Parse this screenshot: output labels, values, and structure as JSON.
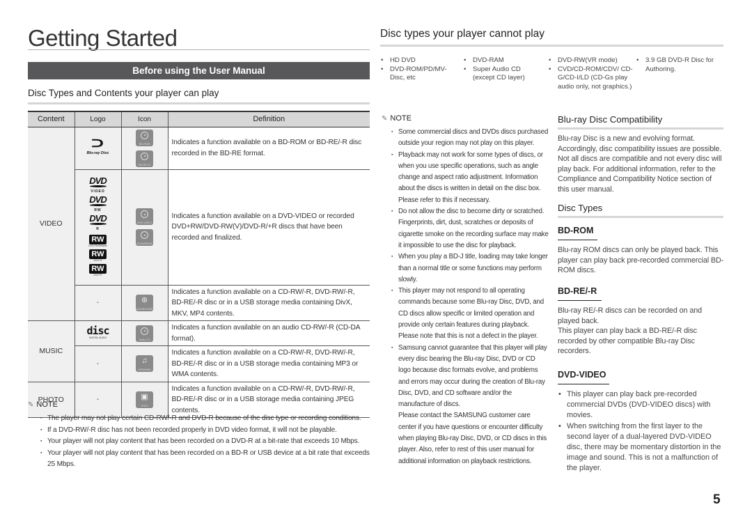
{
  "page": {
    "title": "Getting Started",
    "banner": "Before using the User Manual",
    "page_number": "5"
  },
  "can_play": {
    "heading": "Disc Types and Contents your player can play",
    "columns": [
      "Content",
      "Logo",
      "Icon",
      "Definition"
    ],
    "rows": [
      {
        "content": "VIDEO",
        "logos": [
          "blu-ray-disc-logo"
        ],
        "icons": [
          {
            "name": "bd-rom-icon",
            "caption": "BD-ROM"
          },
          {
            "name": "bd-re-r-icon",
            "caption": "BD-RE/-R"
          }
        ],
        "definition": "Indicates a function available on a BD-ROM or BD-RE/-R disc recorded in the BD-RE format."
      },
      {
        "content": "VIDEO",
        "logos": [
          {
            "name": "dvd-video-logo",
            "text": "DVD",
            "sub": "VIDEO"
          },
          {
            "name": "dvd-rw-logo",
            "text": "DVD",
            "sub": "RW"
          },
          {
            "name": "dvd-r-logo",
            "text": "DVD",
            "sub": "R"
          },
          {
            "name": "rw-dvd-plus-rw-logo",
            "text": "RW",
            "sub": "DVD+ReWritable"
          },
          {
            "name": "rw-dvd-plus-r-logo",
            "text": "RW",
            "sub": "DVD+R"
          },
          {
            "name": "rw-dvd-r-logo",
            "text": "RW",
            "sub": "DVD+R"
          }
        ],
        "icons": [
          {
            "name": "dvd-video-icon",
            "caption": "DVD-VIDEO"
          },
          {
            "name": "dvd-rw-r-icon",
            "caption": "DVD±RW/±R"
          }
        ],
        "definition": "Indicates a function available on a DVD-VIDEO or recorded DVD+RW/DVD-RW(V)/DVD-R/+R discs that have been recorded and finalized."
      },
      {
        "content": "VIDEO",
        "logo_text": "-",
        "icons": [
          {
            "name": "divx-mkv-mp4-icon",
            "caption": "DivX/MKV/MP4"
          }
        ],
        "definition": "Indicates a function available on a CD-RW/-R, DVD-RW/-R, BD-RE/-R disc or in a USB storage media containing DivX, MKV, MP4 contents."
      },
      {
        "content": "MUSIC",
        "logo": {
          "text": "disc",
          "sub": "DIGITAL AUDIO"
        },
        "icons": [
          {
            "name": "audio-cd-icon",
            "caption": "Audio CD"
          }
        ],
        "definition": "Indicates a function available on an audio CD-RW/-R (CD-DA format)."
      },
      {
        "content": "MUSIC",
        "logo_text": "-",
        "icons": [
          {
            "name": "mp3-wma-icon",
            "caption": "MP3/WMA"
          }
        ],
        "definition": "Indicates a function available on a CD-RW/-R, DVD-RW/-R, BD-RE/-R disc or in a USB storage media containing MP3 or WMA contents."
      },
      {
        "content": "PHOTO",
        "logo_text": "-",
        "icons": [
          {
            "name": "jpeg-icon",
            "caption": "JPEG"
          }
        ],
        "definition": "Indicates a function available on a CD-RW/-R, DVD-RW/-R, BD-RE/-R disc or in a USB storage media containing JPEG contents."
      }
    ],
    "note": {
      "label": "NOTE",
      "items": [
        "The player may not play certain CD-RW/-R and DVD-R because of the disc type or recording conditions.",
        "If a DVD-RW/-R disc has not been recorded properly in DVD video format, it will not be playable.",
        "Your player will not play content that has been recorded on a DVD-R at a bit-rate that exceeds 10 Mbps.",
        "Your player will not play content that has been recorded on a BD-R or USB device at a bit rate that exceeds 25 Mbps."
      ]
    }
  },
  "cannot_play": {
    "heading": "Disc types your player cannot play",
    "columns": [
      [
        "HD DVD",
        "DVD-ROM/PD/MV-Disc, etc"
      ],
      [
        "DVD-RAM",
        "Super Audio CD (except CD layer)"
      ],
      [
        "DVD-RW(VR mode)",
        "CVD/CD-ROM/CDV/ CD-G/CD-I/LD (CD-Gs play audio only, not graphics.)"
      ],
      [
        "3.9 GB DVD-R Disc for Authoring."
      ]
    ],
    "note": {
      "label": "NOTE",
      "items": [
        "Some commercial discs and DVDs discs purchased outside your region may not play on this player.",
        "Playback may not work for some types of discs, or when you use specific operations, such as angle change and aspect ratio adjustment. Information about the discs is written in detail on the disc box. Please refer to this if necessary.",
        "Do not allow the disc to become dirty or scratched. Fingerprints, dirt, dust, scratches or deposits of cigarette smoke on the recording surface may make it impossible to use the disc for playback.",
        "When you play a BD-J title, loading may take longer than a normal title or some functions may perform slowly.",
        "This player may not respond to all operating commands because some Blu-ray Disc, DVD, and CD discs allow specific or limited operation and provide only certain features during playback. Please note that this is not a defect in the player.",
        "Samsung cannot guarantee that this player will play every disc bearing the Blu-ray Disc, DVD or CD logo because disc formats evolve, and problems and errors may occur during the creation of Blu-ray Disc, DVD, and CD software and/or the manufacture of discs."
      ],
      "continuation": "Please contact the SAMSUNG customer care center if you have questions or encounter difficulty when playing Blu-ray Disc, DVD, or CD discs in this player. Also, refer to rest of this user manual for additional information on playback restrictions."
    }
  },
  "compatibility": {
    "heading": "Blu-ray Disc Compatibility",
    "text": "Blu-ray Disc is a new and evolving format. Accordingly, disc compatibility issues are possible. Not all discs are compatible and not every disc will play back. For additional information, refer to the Compliance and Compatibility Notice section of this user manual."
  },
  "disc_types": {
    "heading": "Disc Types",
    "bd_rom": {
      "heading": "BD-ROM",
      "text": "Blu-ray ROM discs can only be played back. This player can play back pre-recorded commercial BD-ROM discs."
    },
    "bd_re_r": {
      "heading": "BD-RE/-R",
      "text1": "Blu-ray RE/-R discs can be recorded on and played back.",
      "text2": "This player can play back a BD-RE/-R disc recorded by other compatible Blu-ray Disc recorders."
    },
    "dvd_video": {
      "heading": "DVD-VIDEO",
      "items": [
        "This player can play back pre-recorded commercial DVDs (DVD-VIDEO discs) with movies.",
        "When switching from the first layer to the second layer of a dual-layered DVD-VIDEO disc, there may be momentary distortion in the image and sound. This is not a malfunction of the player."
      ]
    }
  }
}
